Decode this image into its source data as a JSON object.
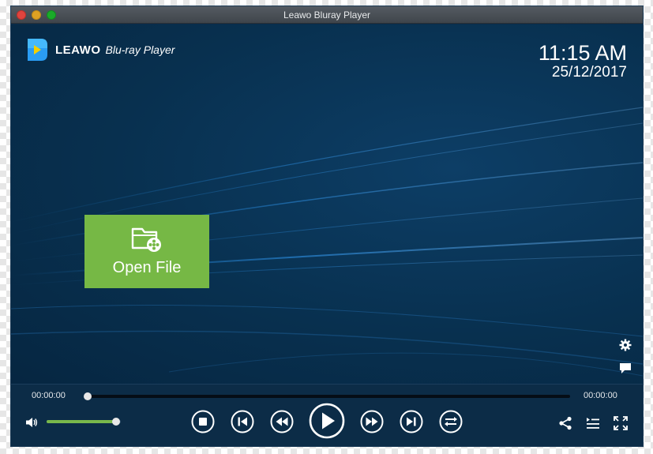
{
  "window": {
    "title": "Leawo Bluray Player"
  },
  "logo": {
    "brand": "LEAWO",
    "product": "Blu-ray Player"
  },
  "clock": {
    "time": "11:15 AM",
    "date": "25/12/2017"
  },
  "open_file": {
    "label": "Open File",
    "icon": "folder-film-icon"
  },
  "playback": {
    "current_time": "00:00:00",
    "total_time": "00:00:00",
    "progress": 0,
    "volume": 0.94
  },
  "colors": {
    "accent": "#76b845",
    "stage": "#0a2c4a",
    "controls": "#0c2c47"
  },
  "icons": {
    "side": [
      "gear-icon",
      "subtitle-icon"
    ],
    "transport": [
      "stop-icon",
      "previous-icon",
      "rewind-icon",
      "play-icon",
      "fast-forward-icon",
      "next-icon",
      "repeat-icon"
    ],
    "right": [
      "share-icon",
      "playlist-icon",
      "fullscreen-icon"
    ]
  }
}
